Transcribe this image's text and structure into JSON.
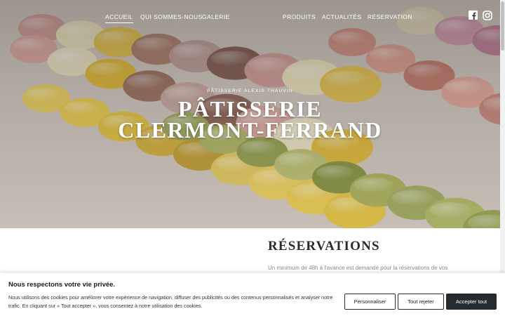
{
  "nav": {
    "left": [
      {
        "label": "ACCUEIL",
        "active": true
      },
      {
        "label": "QUI SOMMES-NOUS",
        "active": false
      },
      {
        "label": "GALERIE",
        "active": false
      }
    ],
    "right": [
      {
        "label": "PRODUITS"
      },
      {
        "label": "ACTUALITÉS"
      },
      {
        "label": "RÉSERVATION"
      }
    ],
    "social": [
      {
        "icon": "facebook-icon"
      },
      {
        "icon": "instagram-icon"
      }
    ]
  },
  "hero": {
    "kicker": "PÂTISSERIE ALEXIS THAUVIN",
    "title_line1": "PÂTISSERIE",
    "title_line2": "CLERMONT-FERRAND"
  },
  "reservations": {
    "title": "RÉSERVATIONS",
    "text": "Un minimum de 48h à l'avance est demandé pour la réservations de vos"
  },
  "cookie": {
    "title": "Nous respectons votre vie privée.",
    "text": "Nous utilisons des cookies pour améliorer votre expérience de navigation, diffuser des publicités ou des contenus personnalisés et analyser notre trafic. En cliquant sur « Tout accepter », vous consentez à notre utilisation des cookies.",
    "buttons": {
      "customize": "Personnaliser",
      "reject": "Tout rejeter",
      "accept": "Accepter tout"
    }
  },
  "colors": {
    "accept_button": "#262b31",
    "hero_text": "#ffffff"
  }
}
